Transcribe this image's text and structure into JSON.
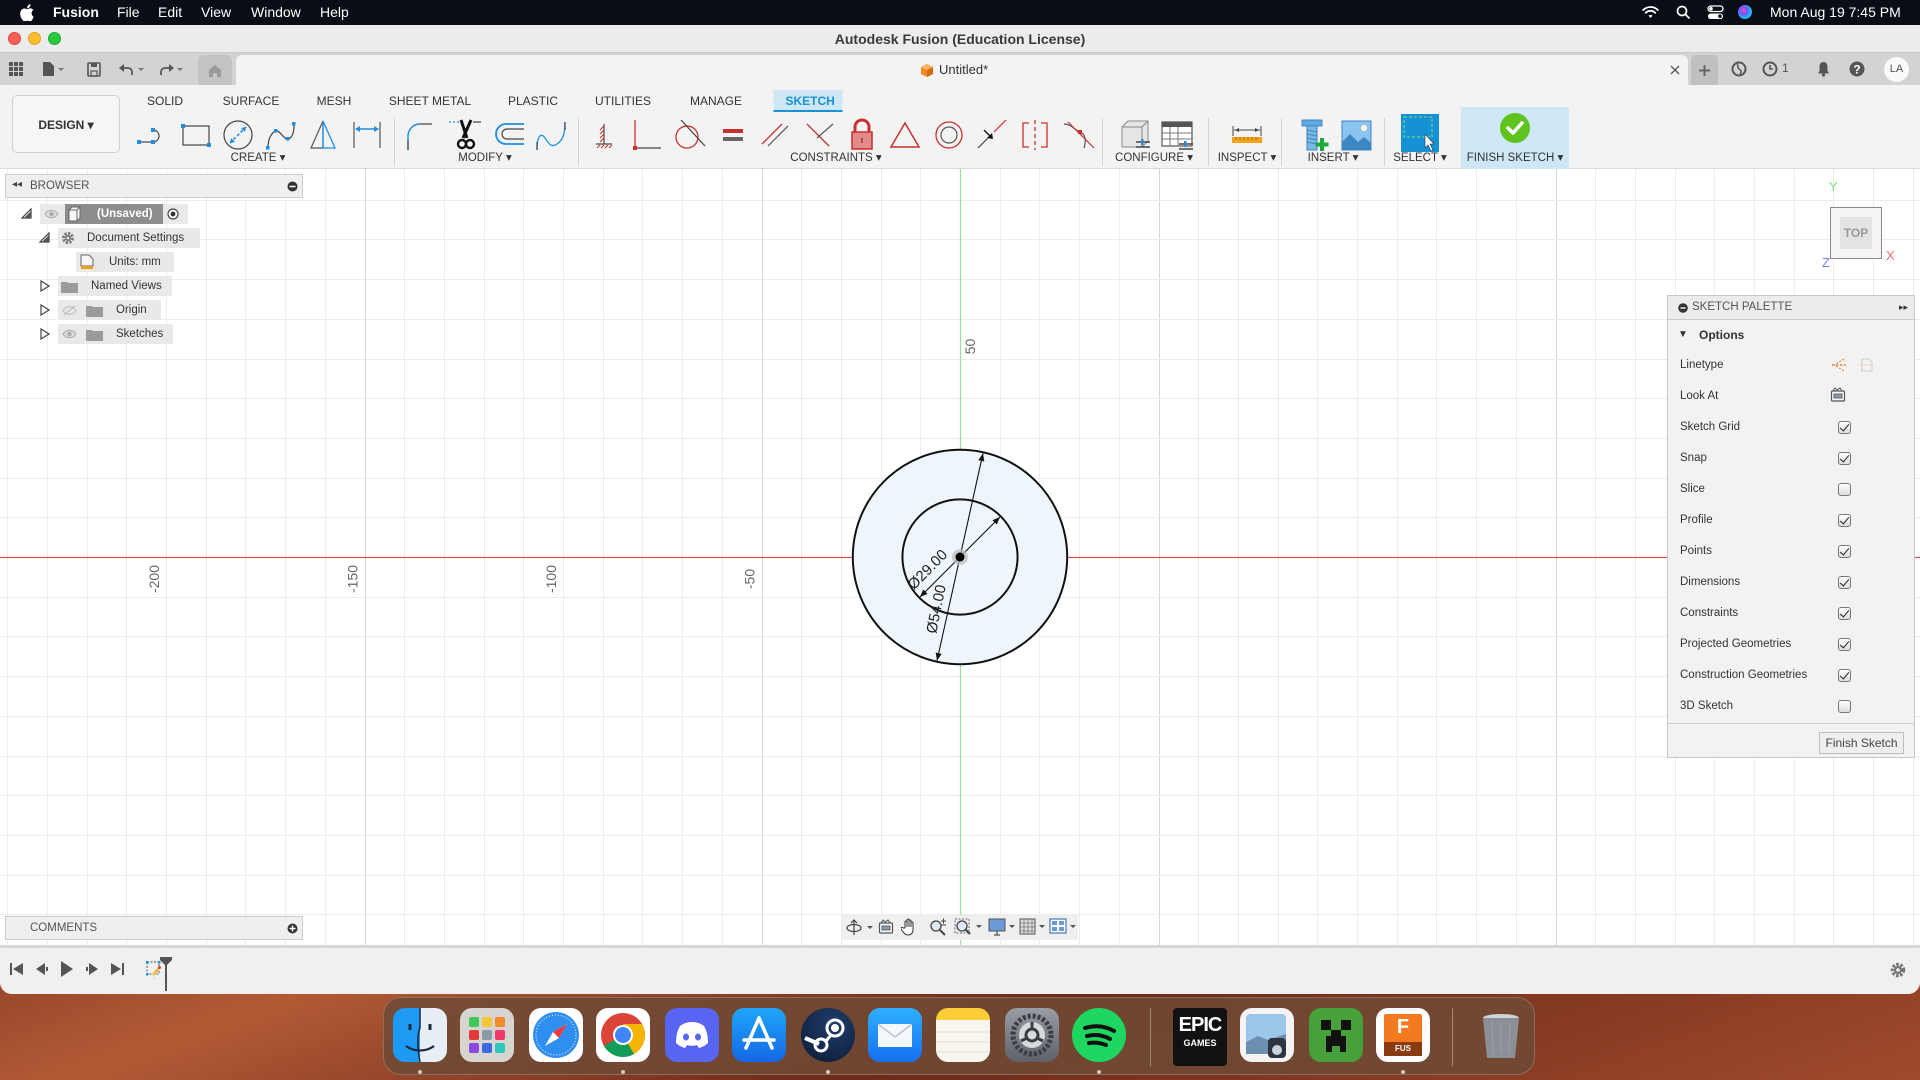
{
  "menubar": {
    "apple_icon": "apple-icon",
    "app": "Fusion",
    "items": [
      "File",
      "Edit",
      "View",
      "Window",
      "Help"
    ],
    "status_icons": [
      "wifi-icon",
      "search-icon",
      "control-center-icon",
      "siri-icon"
    ],
    "clock": "Mon Aug 19  7:45 PM"
  },
  "window": {
    "title": "Autodesk Fusion (Education License)"
  },
  "tabrow": {
    "left_icons": [
      "data-panel-grid-icon",
      "file-icon",
      "save-icon",
      "undo-icon",
      "redo-icon",
      "home-icon"
    ],
    "document_tab": "Untitled*",
    "right_icons": [
      "new-tab-plus-icon",
      "extensions-icon",
      "job-status-icon",
      "notifications-bell-icon",
      "help-icon"
    ],
    "job_count": "1",
    "avatar": "LA"
  },
  "toolbar": {
    "workspace": "DESIGN ▾",
    "tabs": [
      "SOLID",
      "SURFACE",
      "MESH",
      "SHEET METAL",
      "PLASTIC",
      "UTILITIES",
      "MANAGE",
      "SKETCH"
    ],
    "active_tab": "SKETCH",
    "groups": {
      "create": {
        "label": "CREATE ▾",
        "tools": [
          "line",
          "2-point-rectangle",
          "center-diameter-circle",
          "fit-point-spline",
          "mirror",
          "sketch-dimension"
        ]
      },
      "modify": {
        "label": "MODIFY ▾",
        "tools": [
          "fillet",
          "trim",
          "offset",
          "blend-curve"
        ]
      },
      "constraints": {
        "label": "CONSTRAINTS ▾",
        "tools": [
          "horizontal-vertical",
          "coincident",
          "tangent",
          "equal",
          "parallel",
          "perpendicular",
          "fix-unfix",
          "midpoint",
          "concentric",
          "collinear",
          "symmetry",
          "curvature"
        ]
      },
      "configure": {
        "label": "CONFIGURE ▾",
        "tools": [
          "configure-model",
          "configuration-table"
        ]
      },
      "inspect": {
        "label": "INSPECT ▾",
        "tools": [
          "measure"
        ]
      },
      "insert": {
        "label": "INSERT ▾",
        "tools": [
          "insert-mcmaster-carr-component",
          "insert-canvas"
        ]
      },
      "select": {
        "label": "SELECT ▾",
        "tools": [
          "select"
        ]
      },
      "finish": {
        "label": "FINISH SKETCH ▾",
        "tools": [
          "finish-sketch"
        ]
      }
    }
  },
  "browser": {
    "title": "BROWSER",
    "items": [
      {
        "label": "(Unsaved)",
        "expanded": true
      },
      {
        "label": "Document Settings",
        "expanded": true
      },
      {
        "label": "Units: mm"
      },
      {
        "label": "Named Views",
        "expanded": false
      },
      {
        "label": "Origin",
        "expanded": false,
        "visible": false
      },
      {
        "label": "Sketches",
        "expanded": false,
        "visible": true
      }
    ]
  },
  "comments": {
    "title": "COMMENTS"
  },
  "canvas": {
    "x_axis_labels": [
      "-200",
      "-150",
      "-100",
      "-50"
    ],
    "y_axis_labels": [
      "50"
    ],
    "units": "mm",
    "sketch": {
      "circles": [
        {
          "diameter": 54,
          "label": "Ø54.00"
        },
        {
          "diameter": 29,
          "label": "Ø29.00"
        }
      ]
    },
    "viewcube": {
      "face": "TOP",
      "x": "X",
      "y": "Y",
      "z": "Z"
    }
  },
  "palette": {
    "title": "SKETCH PALETTE",
    "section": "Options",
    "linetype_label": "Linetype",
    "lookat_label": "Look At",
    "options": [
      {
        "label": "Sketch Grid",
        "checked": true
      },
      {
        "label": "Snap",
        "checked": true
      },
      {
        "label": "Slice",
        "checked": false
      },
      {
        "label": "Profile",
        "checked": true
      },
      {
        "label": "Points",
        "checked": true
      },
      {
        "label": "Dimensions",
        "checked": true
      },
      {
        "label": "Constraints",
        "checked": true
      },
      {
        "label": "Projected Geometries",
        "checked": true
      },
      {
        "label": "Construction Geometries",
        "checked": true
      },
      {
        "label": "3D Sketch",
        "checked": false
      }
    ],
    "finish_button": "Finish Sketch"
  },
  "navbar": {
    "tools": [
      "orbit",
      "look-at",
      "pan",
      "zoom",
      "fit",
      "display-settings",
      "grid-and-snaps",
      "viewports"
    ]
  },
  "timeline": {
    "controls": [
      "go-to-start",
      "step-back",
      "play",
      "step-forward",
      "go-to-end"
    ],
    "features": [
      "sketch-1"
    ]
  },
  "dock": {
    "apps": [
      {
        "name": "Finder",
        "running": true
      },
      {
        "name": "Launchpad",
        "running": false
      },
      {
        "name": "Safari",
        "running": false
      },
      {
        "name": "Google Chrome",
        "running": true
      },
      {
        "name": "Discord",
        "running": false
      },
      {
        "name": "App Store",
        "running": false
      },
      {
        "name": "Steam",
        "running": true
      },
      {
        "name": "Mail",
        "running": false
      },
      {
        "name": "Notes",
        "running": false
      },
      {
        "name": "System Settings",
        "running": false
      },
      {
        "name": "Spotify",
        "running": true
      },
      {
        "name": "Epic Games Launcher",
        "running": false
      },
      {
        "name": "Preview",
        "running": false
      },
      {
        "name": "Minecraft",
        "running": false
      },
      {
        "name": "Autodesk Fusion",
        "running": true
      },
      {
        "name": "Trash",
        "running": false
      }
    ],
    "epic_text_1": "EPIC",
    "epic_text_2": "GAMES",
    "fusion_badge": "FUS",
    "fusion_letter": "F"
  }
}
